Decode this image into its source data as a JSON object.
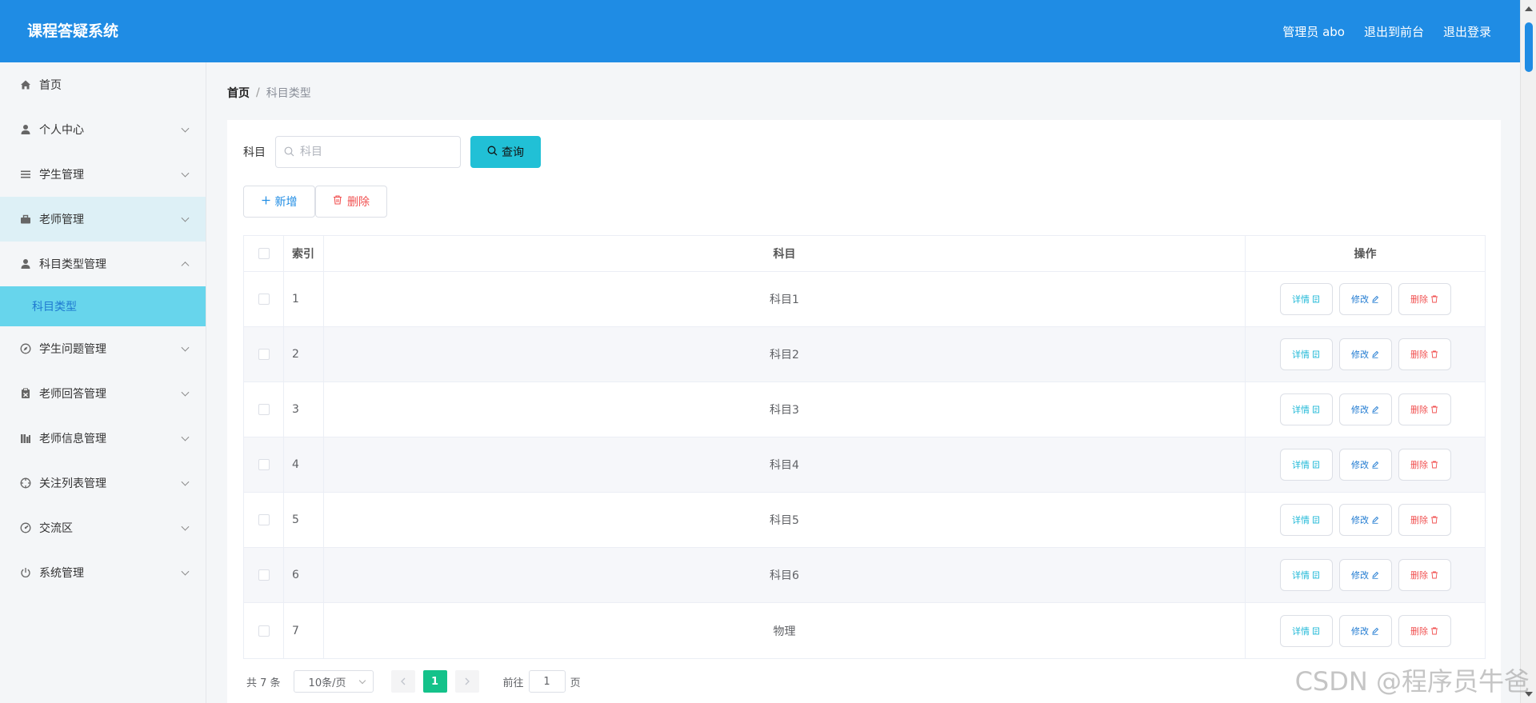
{
  "app": {
    "title": "课程答疑系统",
    "admin_label": "管理员 abo",
    "to_front_label": "退出到前台",
    "logout_label": "退出登录"
  },
  "sidebar": {
    "items": [
      {
        "label": "首页",
        "icon": "home-icon"
      },
      {
        "label": "个人中心",
        "icon": "user-icon"
      },
      {
        "label": "学生管理",
        "icon": "list-icon"
      },
      {
        "label": "老师管理",
        "icon": "briefcase-icon"
      },
      {
        "label": "科目类型管理",
        "icon": "user-icon",
        "expanded": true
      },
      {
        "label": "学生问题管理",
        "icon": "compass-icon"
      },
      {
        "label": "老师回答管理",
        "icon": "clipboard-icon"
      },
      {
        "label": "老师信息管理",
        "icon": "chart-icon"
      },
      {
        "label": "关注列表管理",
        "icon": "target-icon"
      },
      {
        "label": "交流区",
        "icon": "gauge-icon"
      },
      {
        "label": "系统管理",
        "icon": "power-icon"
      }
    ],
    "sub_active": "科目类型"
  },
  "breadcrumb": {
    "home": "首页",
    "separator": "/",
    "current": "科目类型"
  },
  "search": {
    "label": "科目",
    "placeholder": "科目",
    "value": "",
    "button_label": "查询"
  },
  "actions": {
    "add_label": "新增",
    "delete_label": "删除"
  },
  "table": {
    "headers": {
      "index": "索引",
      "subject": "科目",
      "operation": "操作"
    },
    "rows": [
      {
        "index": "1",
        "subject": "科目1"
      },
      {
        "index": "2",
        "subject": "科目2"
      },
      {
        "index": "3",
        "subject": "科目3"
      },
      {
        "index": "4",
        "subject": "科目4"
      },
      {
        "index": "5",
        "subject": "科目5"
      },
      {
        "index": "6",
        "subject": "科目6"
      },
      {
        "index": "7",
        "subject": "物理"
      }
    ],
    "op_labels": {
      "detail": "详情",
      "edit": "修改",
      "delete": "删除"
    }
  },
  "pagination": {
    "total_text": "共 7 条",
    "page_size": "10条/页",
    "current_page": "1",
    "goto_label": "前往",
    "goto_value": "1",
    "page_suffix": "页"
  },
  "watermark": "CSDN @程序员牛爸",
  "colors": {
    "header": "#1f8ce4",
    "query_button": "#21c0d6",
    "active_submenu": "#67d5ec",
    "active_page": "#14c28a",
    "danger": "#f15151"
  }
}
